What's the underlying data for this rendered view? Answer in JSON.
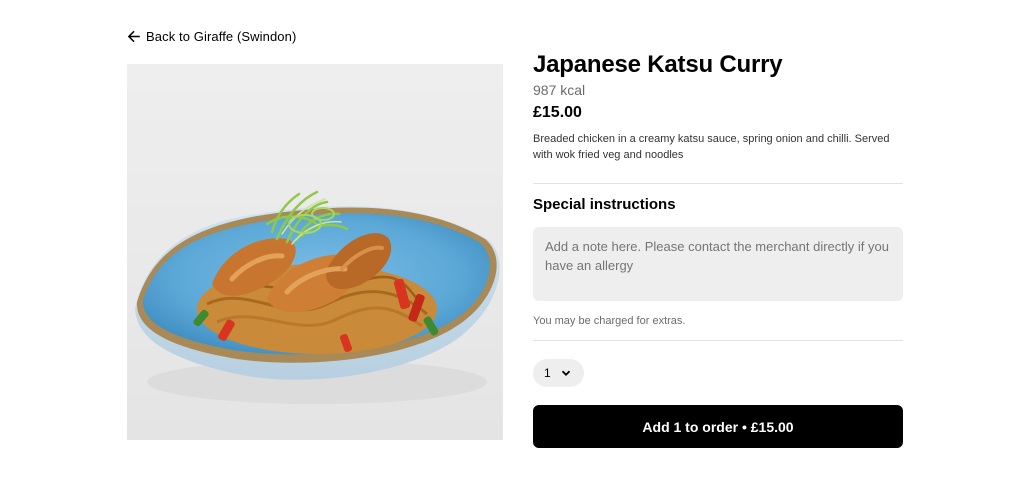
{
  "nav": {
    "back_label": "Back to Giraffe (Swindon)",
    "back_icon": "arrow-left-icon"
  },
  "item": {
    "title": "Japanese Katsu Curry",
    "kcal": "987 kcal",
    "price": "£15.00",
    "description": "Breaded chicken in a creamy katsu sauce, spring onion and chilli. Served with wok fried veg and noodles",
    "image_description": "Katsu curry chicken on noodles with spring onion in a blue bowl"
  },
  "special_instructions": {
    "title": "Special instructions",
    "placeholder": "Add a note here. Please contact the merchant directly if you have an allergy",
    "value": "",
    "note": "You may be charged for extras."
  },
  "quantity": {
    "selected": "1",
    "icon": "chevron-down-icon"
  },
  "order": {
    "button_label": "Add 1 to order • £15.00"
  },
  "colors": {
    "primary": "#000000",
    "field_background": "#eeeeee",
    "muted_text": "#6b6b6b",
    "bowl_blue": "#5aa7d6"
  }
}
